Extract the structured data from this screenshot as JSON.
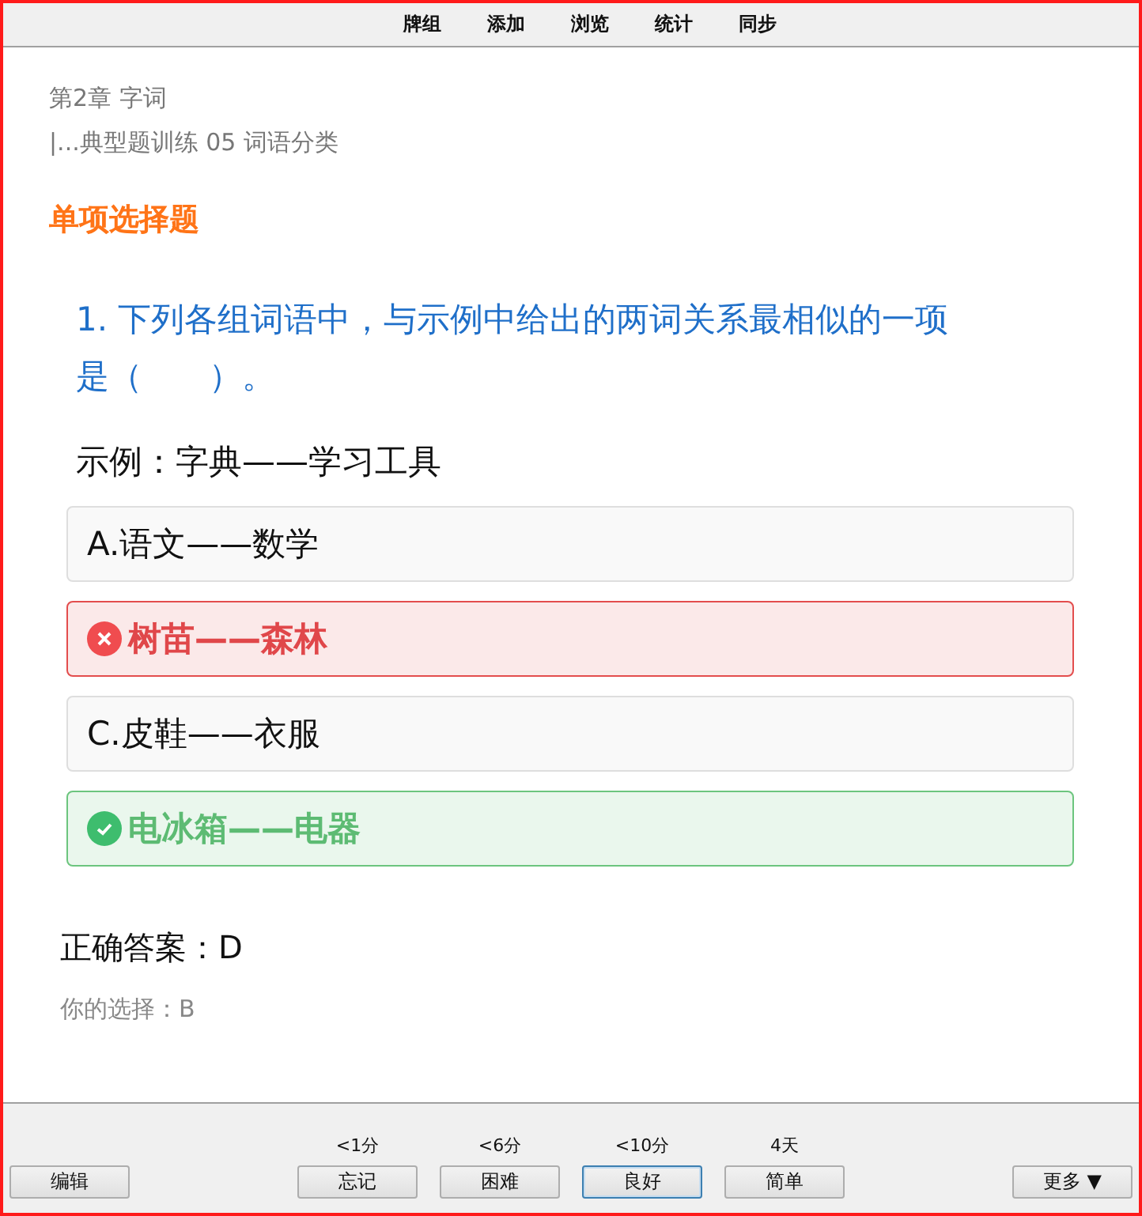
{
  "menu": [
    "牌组",
    "添加",
    "浏览",
    "统计",
    "同步"
  ],
  "breadcrumb": [
    "第2章 字词",
    "|...典型题训练 05 词语分类"
  ],
  "section_title": "单项选择题",
  "question": {
    "number": "1.",
    "text": "下列各组词语中，与示例中给出的两词关系最相似的一项是（　　）。"
  },
  "example": "示例：字典——学习工具",
  "options": [
    {
      "kind": "plain",
      "text": "A.语文——数学"
    },
    {
      "kind": "wrong",
      "text": "树苗——森林"
    },
    {
      "kind": "plain",
      "text": "C.皮鞋——衣服"
    },
    {
      "kind": "correct",
      "text": "电冰箱——电器"
    }
  ],
  "answer": "正确答案：D",
  "your_choice": "你的选择：B",
  "edit_button": "编辑",
  "ease_buttons": [
    {
      "time": "<1分",
      "label": "忘记",
      "selected": false
    },
    {
      "time": "<6分",
      "label": "困难",
      "selected": false
    },
    {
      "time": "<10分",
      "label": "良好",
      "selected": true
    },
    {
      "time": "4天",
      "label": "简单",
      "selected": false
    }
  ],
  "more_button": "更多 ▼"
}
